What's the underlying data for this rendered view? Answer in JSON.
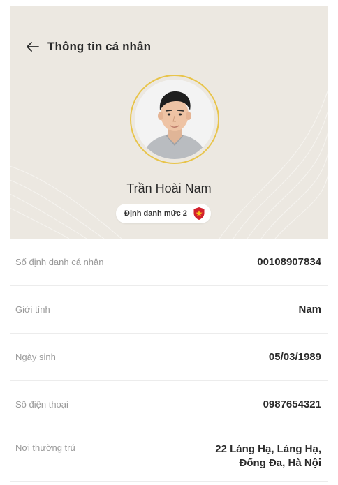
{
  "header": {
    "title": "Thông tin cá nhân",
    "back_icon": "arrow-left-icon"
  },
  "profile": {
    "name": "Trần Hoài Nam",
    "badge_text": "Định danh mức 2",
    "badge_icon": "shield-star-icon",
    "avatar_ring_color": "#e8c44a",
    "shield_color": "#d3212c",
    "star_color": "#f5c518"
  },
  "info": [
    {
      "label": "Số định danh cá nhân",
      "value": "00108907834"
    },
    {
      "label": "Giới tính",
      "value": "Nam"
    },
    {
      "label": "Ngày sinh",
      "value": "05/03/1989"
    },
    {
      "label": "Số điện thoại",
      "value": "0987654321"
    },
    {
      "label": "Nơi thường trú",
      "value_line1": "22 Láng Hạ, Láng Hạ,",
      "value_line2": "Đống Đa, Hà Nội"
    }
  ]
}
